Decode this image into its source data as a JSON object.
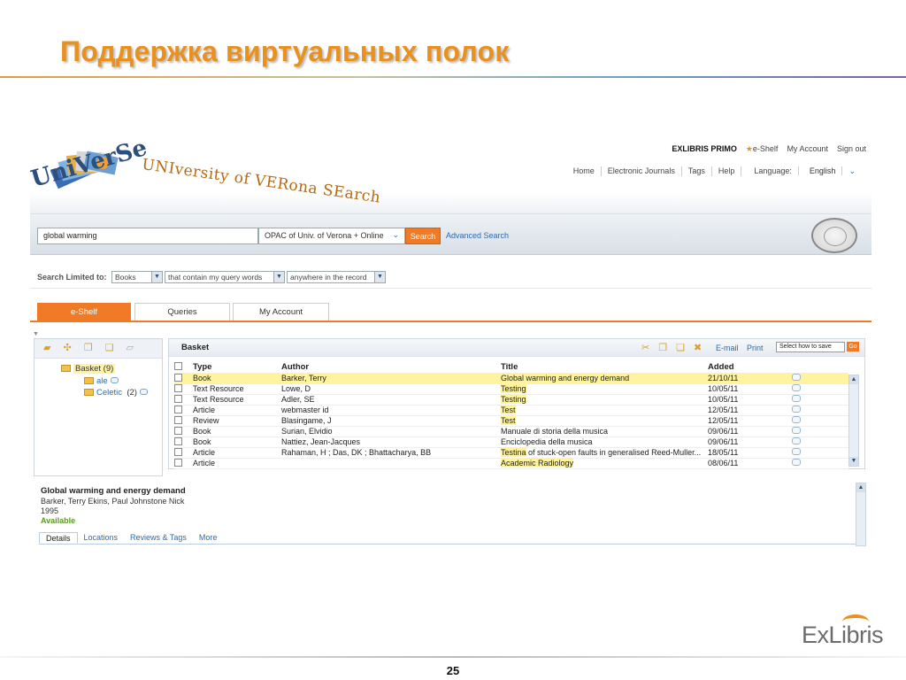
{
  "slide": {
    "title": "Поддержка виртуальных полок",
    "page_number": "25",
    "footer_logo": "ExLibris"
  },
  "app": {
    "top_links": {
      "brand": "EXLIBRIS PRIMO",
      "eshelf": "e-Shelf",
      "my_account": "My Account",
      "sign_out": "Sign out"
    },
    "nav": {
      "home": "Home",
      "ejournals": "Electronic Journals",
      "tags": "Tags",
      "help": "Help",
      "language_label": "Language:",
      "language_value": "English"
    },
    "logo": {
      "univ": "UniVerSe",
      "tagline": "UNIversity of VERona SEarch"
    },
    "search": {
      "query": "global warming",
      "scope": "OPAC of Univ. of Verona + Online",
      "button": "Search",
      "advanced": "Advanced Search"
    },
    "limits": {
      "label": "Search Limited to:",
      "type": "Books",
      "match": "that contain my query words",
      "field": "anywhere in the record"
    },
    "tabs": [
      "e-Shelf",
      "Queries",
      "My Account"
    ],
    "folders": [
      {
        "label": "Basket (9)"
      },
      {
        "label": "ale"
      },
      {
        "label": "Celetic",
        "count": "(2)"
      }
    ],
    "basket": {
      "title": "Basket",
      "email": "E-mail",
      "print": "Print",
      "save_select": "Select how to save",
      "go": "Go",
      "columns": {
        "type": "Type",
        "author": "Author",
        "title": "Title",
        "added": "Added"
      },
      "rows": [
        {
          "type": "Book",
          "author": "Barker, Terry",
          "title": "Global warming and energy demand",
          "title_rest": "",
          "added": "21/10/11",
          "highlight_row": true
        },
        {
          "type": "Text Resource",
          "author": "Lowe, D",
          "title": "Testing",
          "title_rest": "",
          "added": "10/05/11",
          "highlight_title": true
        },
        {
          "type": "Text Resource",
          "author": "Adler, SE",
          "title": "Testing",
          "title_rest": "",
          "added": "10/05/11",
          "highlight_title": true
        },
        {
          "type": "Article",
          "author": "webmaster id",
          "title": "Test",
          "title_rest": "",
          "added": "12/05/11",
          "highlight_title": true
        },
        {
          "type": "Review",
          "author": "Blasingame, J",
          "title": "Test",
          "title_rest": "",
          "added": "12/05/11",
          "highlight_title": true
        },
        {
          "type": "Book",
          "author": "Surian, Elvidio",
          "title": "Manuale di storia della musica",
          "title_rest": "",
          "added": "09/06/11"
        },
        {
          "type": "Book",
          "author": "Nattiez, Jean-Jacques",
          "title": "Enciclopedia della musica",
          "title_rest": "",
          "added": "09/06/11"
        },
        {
          "type": "Article",
          "author": "Rahaman, H ; Das, DK ; Bhattacharya, BB",
          "title": "Testina",
          "title_rest": " of stuck-open faults in generalised Reed-Muller...",
          "added": "18/05/11",
          "highlight_title": true
        },
        {
          "type": "Article",
          "author": "",
          "title": "Academic Radiology",
          "title_rest": "",
          "added": "08/06/11",
          "highlight_title": true
        }
      ]
    },
    "detail": {
      "title": "Global warming and energy demand",
      "authors": "Barker, Terry Ekins, Paul Johnstone Nick",
      "year": "1995",
      "availability": "Available",
      "tabs": [
        "Details",
        "Locations",
        "Reviews & Tags",
        "More"
      ]
    }
  }
}
